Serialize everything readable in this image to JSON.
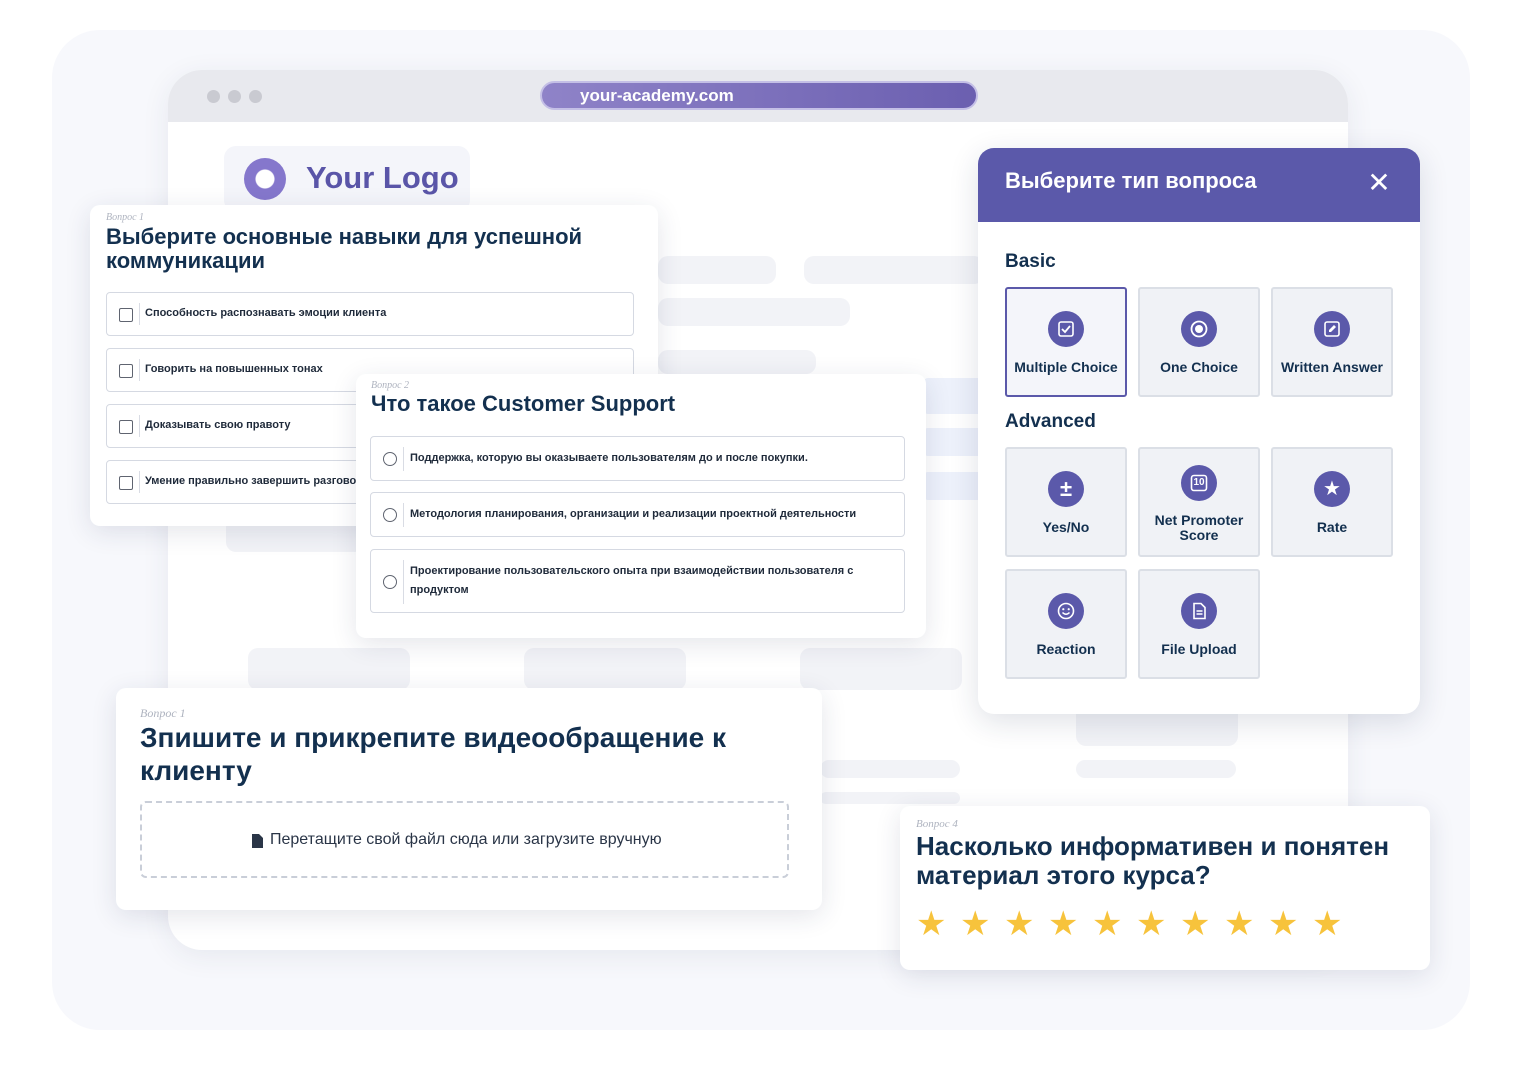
{
  "browser": {
    "url": "your-academy.com"
  },
  "logo": {
    "text": "Your Logo"
  },
  "question1": {
    "label": "Вопрос 1",
    "title_line1": "Выберите основные навыки для успешной",
    "title_line2": "коммуникации",
    "options": [
      "Способность распознавать эмоции клиента",
      "Говорить на повышенных тонах",
      "Доказывать свою правоту",
      "Умение правильно завершить разговор"
    ]
  },
  "question2": {
    "label": "Вопрос 2",
    "title": "Что такое Customer Support",
    "options": [
      "Поддержка, которую вы оказываете пользователям до и после покупки.",
      "Методология планирования, организации и реализации проектной деятельности",
      "Проектирование пользовательского опыта при взаимодействии пользователя с продуктом"
    ]
  },
  "question3": {
    "label": "Вопрос 1",
    "title_line1": "Зпишите и прикрепите видеообращение к",
    "title_line2": "клиенту",
    "dropzone_text": "Перетащите свой файл сюда или загрузите вручную"
  },
  "question4": {
    "label": "Вопрос 4",
    "title_line1": "Насколько информативен и понятен",
    "title_line2": "материал этого курса?",
    "stars": {
      "count": 10,
      "glyph": "★",
      "color": "#f7c33c"
    }
  },
  "modal": {
    "title": "Выберите тип вопроса",
    "close": "✕",
    "basic_label": "Basic",
    "advanced_label": "Advanced",
    "basic": [
      {
        "label": "Multiple Choice",
        "icon": "checkbox-icon",
        "selected": true
      },
      {
        "label": "One Choice",
        "icon": "radio-icon",
        "selected": false
      },
      {
        "label": "Written Answer",
        "icon": "pencil-icon",
        "selected": false
      }
    ],
    "advanced": [
      {
        "label": "Yes/No",
        "icon": "plus-minus-icon",
        "glyph": "±"
      },
      {
        "label_line1": "Net Promoter",
        "label_line2": "Score",
        "icon": "nps-icon",
        "glyph": "10"
      },
      {
        "label": "Rate",
        "icon": "star-icon",
        "glyph": "★"
      },
      {
        "label": "Reaction",
        "icon": "smile-icon"
      },
      {
        "label": "File Upload",
        "icon": "file-icon"
      }
    ]
  },
  "colors": {
    "accent": "#5b59aa",
    "title": "#13304f",
    "star": "#f7c33c",
    "url_bar": "#7a6ebd"
  }
}
